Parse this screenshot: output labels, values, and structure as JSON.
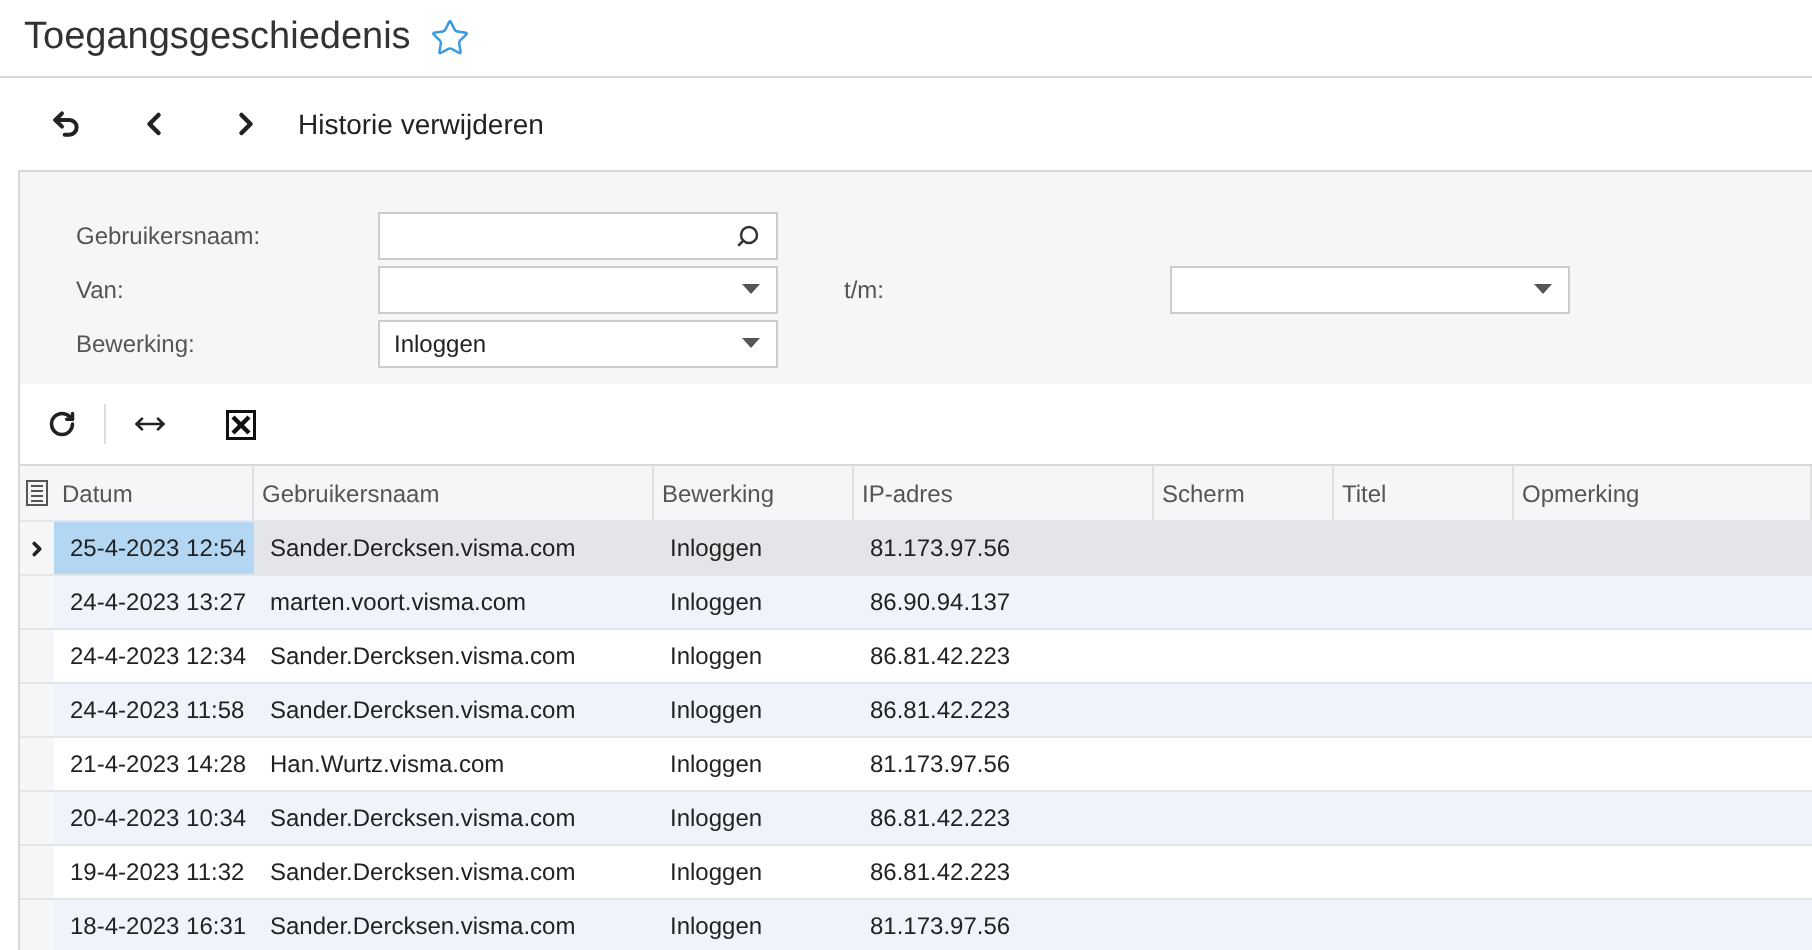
{
  "page": {
    "title": "Toegangsgeschiedenis",
    "favorite": false
  },
  "toolbar": {
    "action": "Historie verwijderen"
  },
  "filters": {
    "username": {
      "label": "Gebruikersnaam:"
    },
    "from": {
      "label": "Van:"
    },
    "to": {
      "label": "t/m:"
    },
    "operation": {
      "label": "Bewerking:",
      "value": "Inloggen"
    }
  },
  "table": {
    "columns": [
      "Datum",
      "Gebruikersnaam",
      "Bewerking",
      "IP-adres",
      "Scherm",
      "Titel",
      "Opmerking"
    ],
    "rows": [
      {
        "selected": true,
        "cells": [
          "25-4-2023 12:54",
          "Sander.Dercksen.visma.com",
          "Inloggen",
          "81.173.97.56"
        ]
      },
      {
        "selected": false,
        "cells": [
          "24-4-2023 13:27",
          "marten.voort.visma.com",
          "Inloggen",
          "86.90.94.137"
        ]
      },
      {
        "selected": false,
        "cells": [
          "24-4-2023 12:34",
          "Sander.Dercksen.visma.com",
          "Inloggen",
          "86.81.42.223"
        ]
      },
      {
        "selected": false,
        "cells": [
          "24-4-2023 11:58",
          "Sander.Dercksen.visma.com",
          "Inloggen",
          "86.81.42.223"
        ]
      },
      {
        "selected": false,
        "cells": [
          "21-4-2023 14:28",
          "Han.Wurtz.visma.com",
          "Inloggen",
          "81.173.97.56"
        ]
      },
      {
        "selected": false,
        "cells": [
          "20-4-2023 10:34",
          "Sander.Dercksen.visma.com",
          "Inloggen",
          "86.81.42.223"
        ]
      },
      {
        "selected": false,
        "cells": [
          "19-4-2023 11:32",
          "Sander.Dercksen.visma.com",
          "Inloggen",
          "86.81.42.223"
        ]
      },
      {
        "selected": false,
        "cells": [
          "18-4-2023 16:31",
          "Sander.Dercksen.visma.com",
          "Inloggen",
          "81.173.97.56"
        ]
      }
    ]
  }
}
